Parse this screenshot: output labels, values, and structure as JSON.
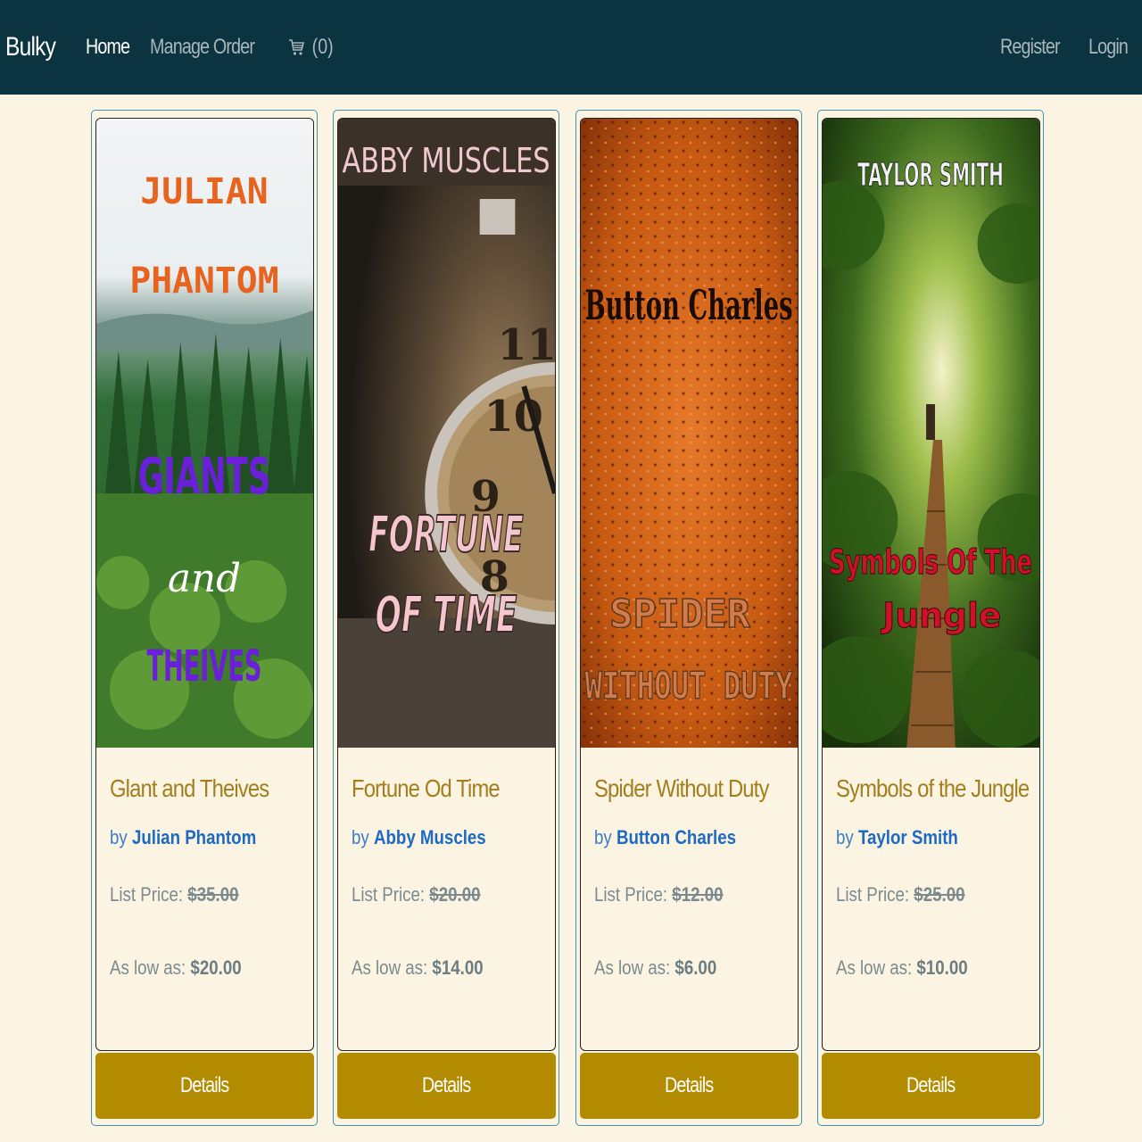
{
  "nav": {
    "brand": "Bulky",
    "home": "Home",
    "manage_order": "Manage Order",
    "cart_count": "(0)",
    "register": "Register",
    "login": "Login"
  },
  "colors": {
    "navbar": "#0b3340",
    "background": "#fbf4e2",
    "title": "#a37e1d",
    "author": "#1e6ac1",
    "button": "#b38b00"
  },
  "products": [
    {
      "title": "Glant and Theives",
      "by": "by",
      "author": "Julian Phantom",
      "list_price_label": "List Price:",
      "list_price": "$35.00",
      "low_label": "As low as:",
      "low_price": "$20.00",
      "details": "Details",
      "cover": {
        "author_line1": "JULIAN",
        "author_line2": "PHANTOM",
        "title_line1": "GIANTS",
        "title_line2": "and",
        "title_line3": "THEIVES"
      }
    },
    {
      "title": "Fortune Od Time",
      "by": "by",
      "author": "Abby Muscles",
      "list_price_label": "List Price:",
      "list_price": "$20.00",
      "low_label": "As low as:",
      "low_price": "$14.00",
      "details": "Details",
      "cover": {
        "author_line1": "ABBY MUSCLES",
        "title_line1": "FORTUNE",
        "title_line2": "OF TIME"
      }
    },
    {
      "title": "Spider Without Duty",
      "by": "by",
      "author": "Button Charles",
      "list_price_label": "List Price:",
      "list_price": "$12.00",
      "low_label": "As low as:",
      "low_price": "$6.00",
      "details": "Details",
      "cover": {
        "author_line1": "Button Charles",
        "title_line1": "SPIDER",
        "title_line2": "WITHOUT DUTY"
      }
    },
    {
      "title": "Symbols of the Jungle",
      "by": "by",
      "author": "Taylor Smith",
      "list_price_label": "List Price:",
      "list_price": "$25.00",
      "low_label": "As low as:",
      "low_price": "$10.00",
      "details": "Details",
      "cover": {
        "author_line1": "TAYLOR SMITH",
        "title_line1": "Symbols Of The",
        "title_line2": "Jungle"
      }
    }
  ]
}
